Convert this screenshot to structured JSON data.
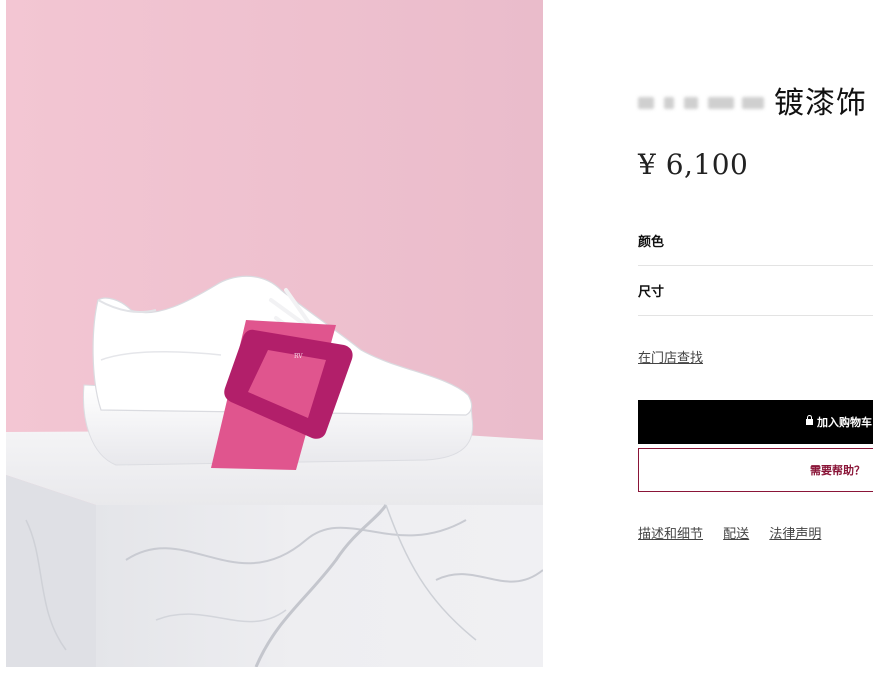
{
  "product": {
    "title_visible": "镀漆饰",
    "price": "¥ 6,100",
    "image_alt": "product-photo"
  },
  "options": {
    "color_label": "颜色",
    "size_label": "尺寸"
  },
  "links": {
    "find_in_store": "在门店查找"
  },
  "actions": {
    "add_to_cart": "加入购物车",
    "need_help": "需要帮助？"
  },
  "tabs": [
    "描述和细节",
    "配送",
    "法律声明"
  ],
  "colors": {
    "accent": "#8a1538",
    "buckle": "#b21f6a",
    "strap": "#e0558e",
    "background_pink": "#efc4d0"
  }
}
